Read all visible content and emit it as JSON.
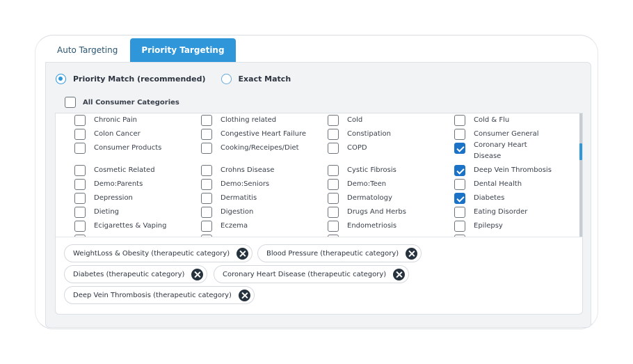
{
  "tabs": [
    {
      "label": "Auto Targeting",
      "active": false
    },
    {
      "label": "Priority Targeting",
      "active": true
    }
  ],
  "match_options": [
    {
      "label": "Priority Match (recommended)",
      "selected": true
    },
    {
      "label": "Exact Match",
      "selected": false
    }
  ],
  "all_categories": {
    "label": "All Consumer Categories",
    "checked": false
  },
  "categories": [
    [
      {
        "label": "Chronic Pain",
        "checked": false
      },
      {
        "label": "Clothing related",
        "checked": false
      },
      {
        "label": "Cold",
        "checked": false
      },
      {
        "label": "Cold & Flu",
        "checked": false
      }
    ],
    [
      {
        "label": "Colon Cancer",
        "checked": false
      },
      {
        "label": "Congestive Heart Failure",
        "checked": false
      },
      {
        "label": "Constipation",
        "checked": false
      },
      {
        "label": "Consumer General",
        "checked": false
      }
    ],
    [
      {
        "label": "Consumer Products",
        "checked": false
      },
      {
        "label": "Cooking/Receipes/Diet",
        "checked": false
      },
      {
        "label": "COPD",
        "checked": false
      },
      {
        "label": "Coronary Heart Disease",
        "checked": true
      }
    ],
    [
      {
        "label": "Cosmetic Related",
        "checked": false
      },
      {
        "label": "Crohns Disease",
        "checked": false
      },
      {
        "label": "Cystic Fibrosis",
        "checked": false
      },
      {
        "label": "Deep Vein Thrombosis",
        "checked": true
      }
    ],
    [
      {
        "label": "Demo:Parents",
        "checked": false
      },
      {
        "label": "Demo:Seniors",
        "checked": false
      },
      {
        "label": "Demo:Teen",
        "checked": false
      },
      {
        "label": "Dental Health",
        "checked": false
      }
    ],
    [
      {
        "label": "Depression",
        "checked": false
      },
      {
        "label": "Dermatitis",
        "checked": false
      },
      {
        "label": "Dermatology",
        "checked": false
      },
      {
        "label": "Diabetes",
        "checked": true
      }
    ],
    [
      {
        "label": "Dieting",
        "checked": false
      },
      {
        "label": "Digestion",
        "checked": false
      },
      {
        "label": "Drugs And Herbs",
        "checked": false
      },
      {
        "label": "Eating Disorder",
        "checked": false
      }
    ],
    [
      {
        "label": "Ecigarettes & Vaping",
        "checked": false
      },
      {
        "label": "Eczema",
        "checked": false
      },
      {
        "label": "Endometriosis",
        "checked": false
      },
      {
        "label": "Epilepsy",
        "checked": false
      }
    ]
  ],
  "selected_chips": [
    {
      "label": "WeightLoss & Obesity (therapeutic category)"
    },
    {
      "label": "Blood Pressure (therapeutic category)"
    },
    {
      "label": "Diabetes (therapeutic category)"
    },
    {
      "label": "Coronary Heart Disease (therapeutic category)"
    },
    {
      "label": "Deep Vein Thrombosis (therapeutic category)"
    }
  ],
  "colors": {
    "accent": "#2f97d9",
    "checkbox_checked": "#1a73c7",
    "chip_remove": "#26323e"
  }
}
